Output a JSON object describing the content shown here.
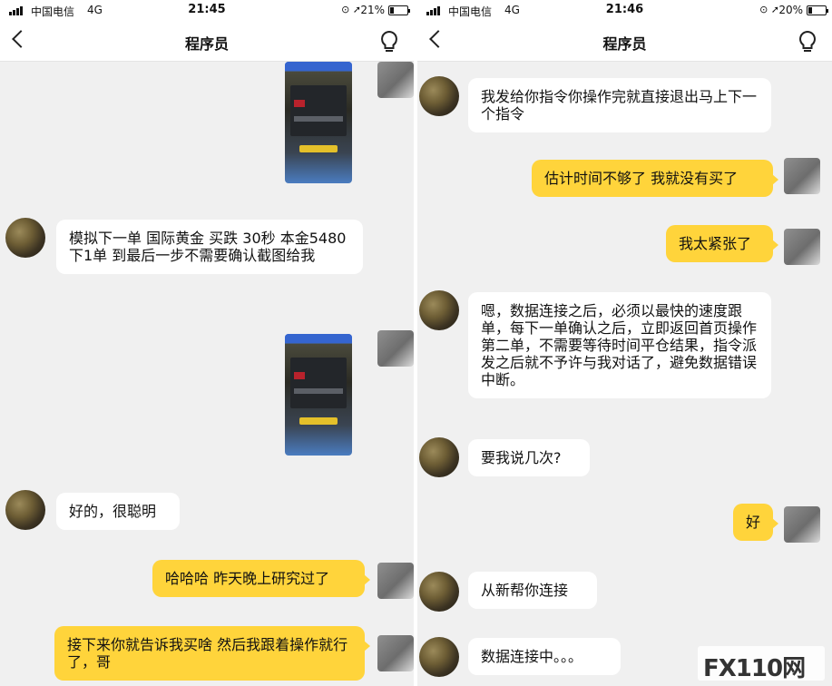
{
  "left": {
    "status": {
      "carrier": "中国电信",
      "network": "4G",
      "time": "21:45",
      "battery": "21%",
      "battery_level": 0.21
    },
    "nav": {
      "title": "程序员"
    },
    "messages": [
      "模拟下一单 国际黄金  买跌 30秒  本金5480  下1单 到最后一步不需要确认截图给我",
      "好的，很聪明",
      "哈哈哈  昨天晚上研究过了",
      "接下来你就告诉我买啥 然后我跟着操作就行了，哥"
    ]
  },
  "right": {
    "status": {
      "carrier": "中国电信",
      "network": "4G",
      "time": "21:46",
      "battery": "20%",
      "battery_level": 0.2
    },
    "nav": {
      "title": "程序员"
    },
    "messages": [
      "我发给你指令你操作完就直接退出马上下一个指令",
      "估计时间不够了 我就没有买了",
      "我太紧张了",
      "嗯，数据连接之后，必须以最快的速度跟单，每下一单确认之后，立即返回首页操作第二单，不需要等待时间平仓结果，指令派发之后就不予许与我对话了，避免数据错误中断。",
      "要我说几次?",
      "好",
      "从新帮你连接",
      "数据连接中。。。"
    ]
  },
  "watermark": {
    "text": "FX110网"
  },
  "colors": {
    "outgoing_bubble": "#ffd43b",
    "incoming_bubble": "#ffffff",
    "background": "#f0f0f0"
  }
}
